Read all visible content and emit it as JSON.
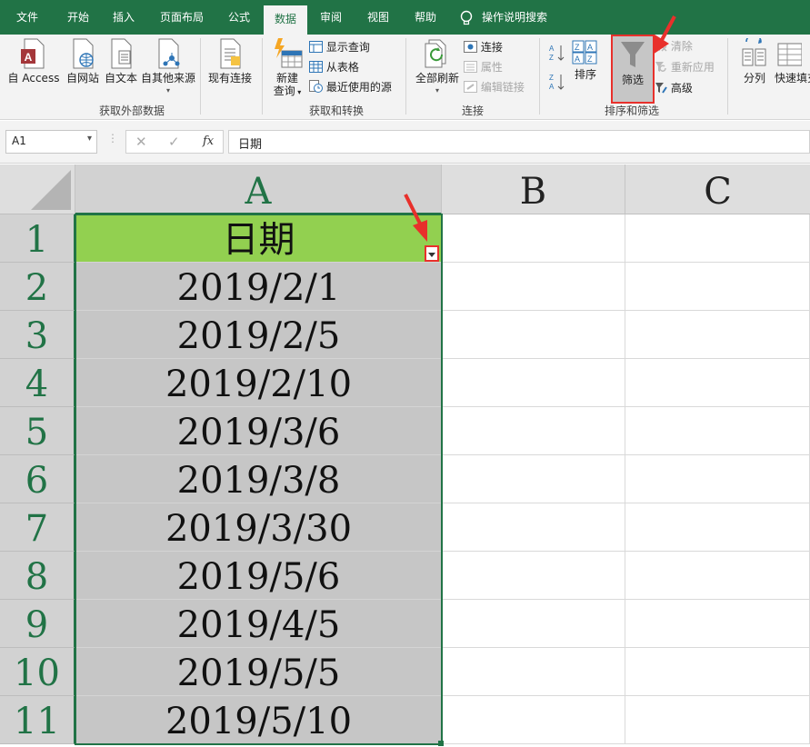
{
  "tabs": [
    "文件",
    "开始",
    "插入",
    "页面布局",
    "公式",
    "数据",
    "审阅",
    "视图",
    "帮助",
    "操作说明搜索"
  ],
  "active_tab": "数据",
  "ribbon": {
    "groups": {
      "get_external": {
        "label": "获取外部数据",
        "buttons": [
          "自 Access",
          "自网站",
          "自文本",
          "自其他来源",
          "现有连接"
        ]
      },
      "get_transform": {
        "label": "获取和转换",
        "new_query": "新建",
        "new_query_2": "查询",
        "show_queries": "显示查询",
        "from_table": "从表格",
        "recent_sources": "最近使用的源"
      },
      "connections": {
        "label": "连接",
        "refresh_all": "全部刷新",
        "connections": "连接",
        "properties": "属性",
        "edit_links": "编辑链接"
      },
      "sort_filter": {
        "label": "排序和筛选",
        "sort": "排序",
        "filter": "筛选",
        "clear": "清除",
        "reapply": "重新应用",
        "advanced": "高级"
      },
      "data_tools": {
        "split": "分列",
        "flash_fill": "快速填充"
      }
    }
  },
  "formula_bar": {
    "name_box": "A1",
    "content": "日期"
  },
  "columns": [
    "A",
    "B",
    "C"
  ],
  "rows": [
    {
      "n": "1",
      "a": "日期"
    },
    {
      "n": "2",
      "a": "2019/2/1"
    },
    {
      "n": "3",
      "a": "2019/2/5"
    },
    {
      "n": "4",
      "a": "2019/2/10"
    },
    {
      "n": "5",
      "a": "2019/3/6"
    },
    {
      "n": "6",
      "a": "2019/3/8"
    },
    {
      "n": "7",
      "a": "2019/3/30"
    },
    {
      "n": "8",
      "a": "2019/5/6"
    },
    {
      "n": "9",
      "a": "2019/4/5"
    },
    {
      "n": "10",
      "a": "2019/5/5"
    },
    {
      "n": "11",
      "a": "2019/5/10"
    }
  ],
  "colors": {
    "excel_green": "#217346",
    "header_fill": "#92d050",
    "highlight_red": "#e8302b"
  }
}
